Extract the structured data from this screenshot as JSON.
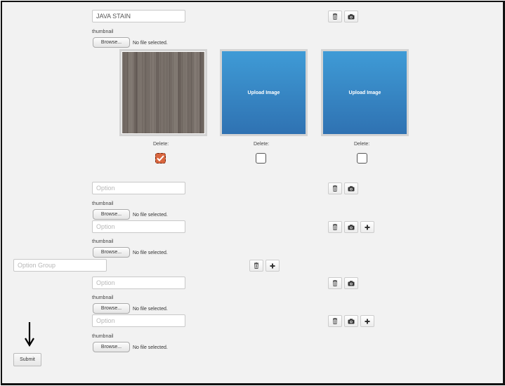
{
  "form": {
    "item": {
      "value": "JAVA STAIN"
    },
    "thumbnail_label": "thumbnail",
    "browse_label": "Browse...",
    "no_file_text": "No file selected.",
    "delete_label": "Delete:",
    "upload_label": "Upload Image",
    "option_placeholder": "Option",
    "option_group_placeholder": "Option Group",
    "submit_label": "Submit"
  },
  "images": [
    {
      "type": "wood-texture",
      "delete_checked": true
    },
    {
      "type": "upload",
      "delete_checked": false
    },
    {
      "type": "upload",
      "delete_checked": false
    }
  ],
  "icons": {
    "trash": "trash-icon",
    "camera": "camera-icon",
    "plus": "plus-icon",
    "arrow": "arrow-down-icon"
  },
  "colors": {
    "upload_blue": "#3686c6",
    "checked_orange": "#d9663f"
  }
}
